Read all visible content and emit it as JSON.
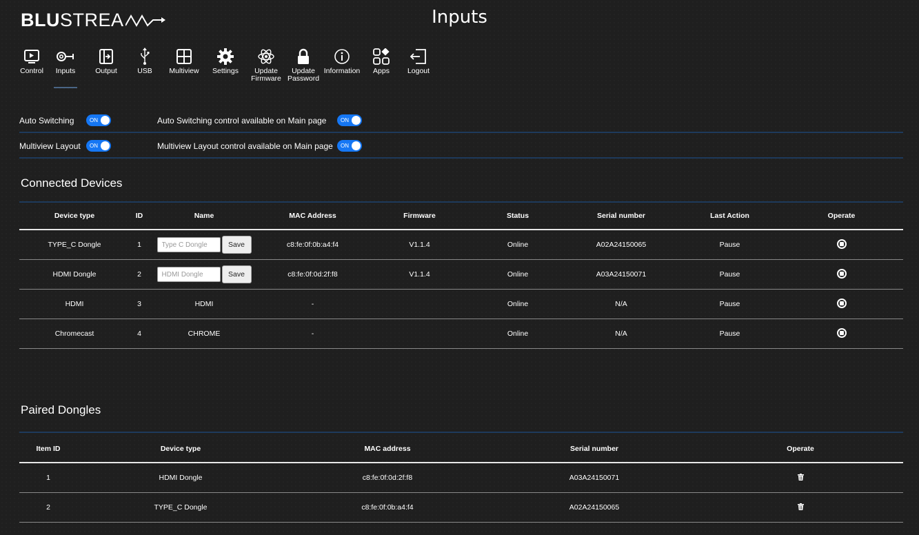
{
  "logo": {
    "bold": "BLU",
    "rest": "STREA"
  },
  "page_title": "Inputs",
  "nav": [
    {
      "label": "Control",
      "icon": "play-icon",
      "active": false
    },
    {
      "label": "Inputs",
      "icon": "input-icon",
      "active": true
    },
    {
      "label": "Output",
      "icon": "output-icon",
      "active": false
    },
    {
      "label": "USB",
      "icon": "usb-icon",
      "active": false
    },
    {
      "label": "Multiview",
      "icon": "multiview-icon",
      "active": false
    },
    {
      "label": "Settings",
      "icon": "gear-icon",
      "active": false
    },
    {
      "label": "Update\nFirmware",
      "icon": "atom-icon",
      "active": false
    },
    {
      "label": "Update\nPassword",
      "icon": "lock-icon",
      "active": false
    },
    {
      "label": "Information",
      "icon": "info-icon",
      "active": false
    },
    {
      "label": "Apps",
      "icon": "apps-icon",
      "active": false
    },
    {
      "label": "Logout",
      "icon": "logout-icon",
      "active": false
    }
  ],
  "settings": {
    "auto_switching": {
      "label": "Auto Switching",
      "toggle": "ON",
      "main_label": "Auto Switching control available on Main page",
      "main_toggle": "ON"
    },
    "multiview": {
      "label": "Multiview Layout",
      "toggle": "ON",
      "main_label": "Multiview Layout control available on Main page",
      "main_toggle": "ON"
    }
  },
  "connected": {
    "title": "Connected Devices",
    "headers": [
      "Device type",
      "ID",
      "Name",
      "MAC Address",
      "Firmware",
      "Status",
      "Serial number",
      "Last Action",
      "Operate"
    ],
    "save_label": "Save",
    "rows": [
      {
        "type": "TYPE_C Dongle",
        "id": "1",
        "name_placeholder": "Type C Dongle",
        "editable": true,
        "mac": "c8:fe:0f:0b:a4:f4",
        "firmware": "V1.1.4",
        "status": "Online",
        "serial": "A02A24150065",
        "last_action": "Pause"
      },
      {
        "type": "HDMI Dongle",
        "id": "2",
        "name_placeholder": "HDMI Dongle",
        "editable": true,
        "mac": "c8:fe:0f:0d:2f:f8",
        "firmware": "V1.1.4",
        "status": "Online",
        "serial": "A03A24150071",
        "last_action": "Pause"
      },
      {
        "type": "HDMI",
        "id": "3",
        "name": "HDMI",
        "editable": false,
        "mac": "-",
        "firmware": "",
        "status": "Online",
        "serial": "N/A",
        "last_action": "Pause"
      },
      {
        "type": "Chromecast",
        "id": "4",
        "name": "CHROME",
        "editable": false,
        "mac": "-",
        "firmware": "",
        "status": "Online",
        "serial": "N/A",
        "last_action": "Pause"
      }
    ]
  },
  "paired": {
    "title": "Paired Dongles",
    "headers": [
      "Item ID",
      "Device type",
      "MAC address",
      "Serial number",
      "Operate"
    ],
    "rows": [
      {
        "id": "1",
        "type": "HDMI Dongle",
        "mac": "c8:fe:0f:0d:2f:f8",
        "serial": "A03A24150071"
      },
      {
        "id": "2",
        "type": "TYPE_C Dongle",
        "mac": "c8:fe:0f:0b:a4:f4",
        "serial": "A02A24150065"
      }
    ]
  },
  "colors": {
    "toggle_on": "#1577f4",
    "separator": "#1e3a5c",
    "background": "#1f1f1f"
  }
}
